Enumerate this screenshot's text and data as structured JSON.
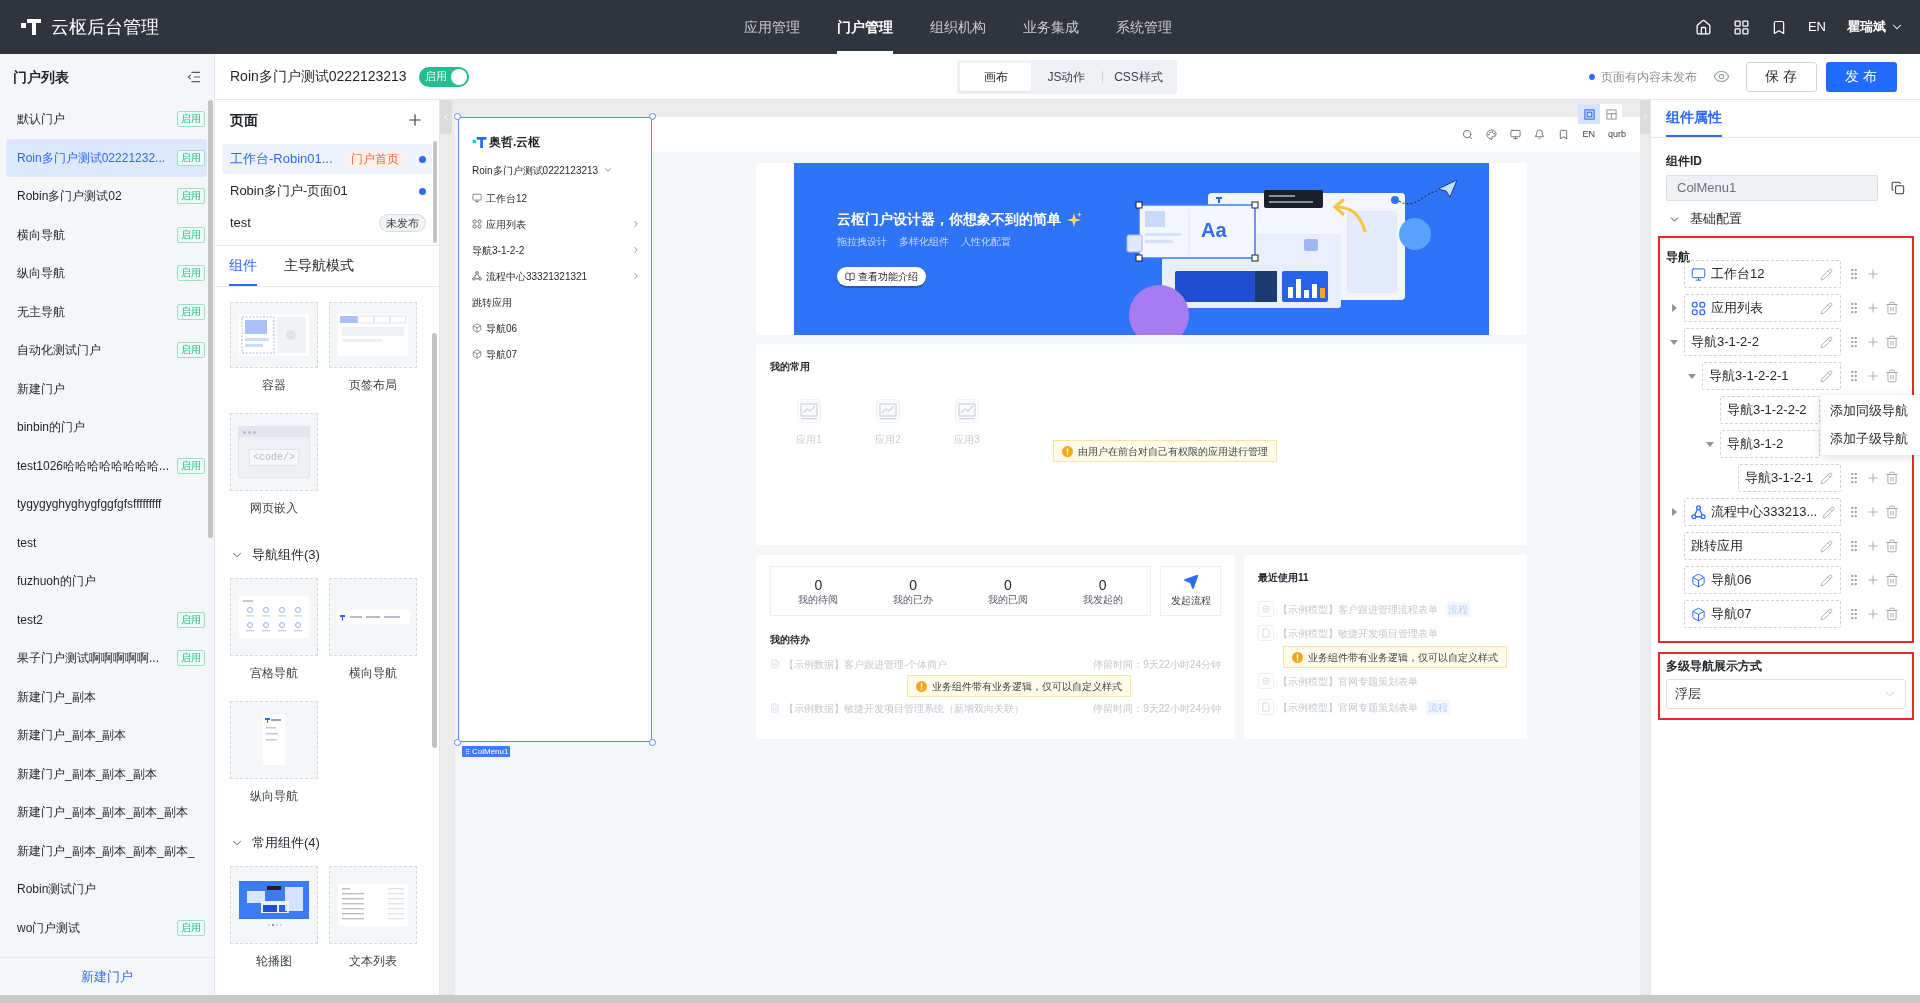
{
  "topbar": {
    "brand": "云枢后台管理",
    "nav": [
      {
        "label": "应用管理",
        "selected": false
      },
      {
        "label": "门户管理",
        "selected": true
      },
      {
        "label": "组织机构",
        "selected": false
      },
      {
        "label": "业务集成",
        "selected": false
      },
      {
        "label": "系统管理",
        "selected": false
      }
    ],
    "language": "EN",
    "user": "瞿瑞斌"
  },
  "portal_list": {
    "title": "门户列表",
    "items": [
      {
        "name": "默认门户",
        "badge": "启用",
        "selected": false
      },
      {
        "name": "Roin多门户测试02221232...",
        "badge": "启用",
        "selected": true
      },
      {
        "name": "Robin多门户测试02",
        "badge": "启用",
        "selected": false
      },
      {
        "name": "横向导航",
        "badge": "启用",
        "selected": false
      },
      {
        "name": "纵向导航",
        "badge": "启用",
        "selected": false
      },
      {
        "name": "无主导航",
        "badge": "启用",
        "selected": false
      },
      {
        "name": "自动化测试门户",
        "badge": "启用",
        "selected": false
      },
      {
        "name": "新建门户",
        "selected": false
      },
      {
        "name": "binbin的门户",
        "selected": false
      },
      {
        "name": "test1026哈哈哈哈哈哈哈哈...",
        "badge": "启用",
        "selected": false
      },
      {
        "name": "tygygyghyghygfggfgfsfffffffff",
        "selected": false
      },
      {
        "name": "test",
        "selected": false
      },
      {
        "name": "fuzhuoh的门户",
        "selected": false
      },
      {
        "name": "test2",
        "badge": "启用",
        "selected": false
      },
      {
        "name": "果子门户测试啊啊啊啊啊...",
        "badge": "启用",
        "selected": false
      },
      {
        "name": "新建门户_副本",
        "selected": false
      },
      {
        "name": "新建门户_副本_副本",
        "selected": false
      },
      {
        "name": "新建门户_副本_副本_副本",
        "selected": false
      },
      {
        "name": "新建门户_副本_副本_副本_副本",
        "selected": false
      },
      {
        "name": "新建门户_副本_副本_副本_副本_",
        "selected": false
      },
      {
        "name": "Robin测试门户",
        "selected": false
      },
      {
        "name": "wo门户测试",
        "badge": "启用",
        "selected": false
      }
    ],
    "new_button": "新建门户"
  },
  "editor_header": {
    "portal_name": "Roin多门户测试0222123213",
    "toggle": {
      "label": "启用",
      "on": true
    },
    "modes": [
      {
        "label": "画布",
        "selected": true
      },
      {
        "label": "JS动作",
        "selected": false
      },
      {
        "label": "CSS样式",
        "selected": false
      }
    ],
    "status": "页面有内容未发布",
    "save": "保存",
    "publish": "发布"
  },
  "pages": {
    "title": "页面",
    "items": [
      {
        "name": "工作台-Robin01...",
        "badge": {
          "text": "门户首页",
          "kind": "home"
        },
        "dot": true,
        "selected": true
      },
      {
        "name": "Robin多门户-页面01",
        "dot": true,
        "selected": false
      },
      {
        "name": "test",
        "badge": {
          "text": "未发布",
          "kind": "draft"
        },
        "dot": false,
        "selected": false
      }
    ]
  },
  "library": {
    "tabs": [
      {
        "label": "组件",
        "selected": true
      },
      {
        "label": "主导航模式",
        "selected": false
      }
    ],
    "groups": [
      {
        "components": [
          {
            "label": "容器",
            "kind": "container"
          },
          {
            "label": "页签布局",
            "kind": "tabs"
          },
          {
            "label": "网页嵌入",
            "kind": "embed",
            "thumbnail_text": "<code/>"
          }
        ]
      },
      {
        "title": "导航组件(3)",
        "expanded": true,
        "components": [
          {
            "label": "宫格导航",
            "kind": "grid_nav"
          },
          {
            "label": "横向导航",
            "kind": "horizontal_nav"
          },
          {
            "label": "纵向导航",
            "kind": "vertical_nav"
          }
        ]
      },
      {
        "title": "常用组件(4)",
        "expanded": true,
        "components": [
          {
            "label": "轮播图",
            "kind": "carousel"
          },
          {
            "label": "文本列表",
            "kind": "text_list"
          }
        ]
      }
    ]
  },
  "canvas": {
    "view_toggles": [
      {
        "selected": true
      },
      {
        "selected": false
      }
    ],
    "preview": {
      "nav_menu": {
        "tag": "ColMenu1",
        "selected": true,
        "logo": "奥哲.云枢",
        "portal": "Roin多门户测试0222123213",
        "items": [
          {
            "label": "工作台12",
            "kind": "workbench",
            "has_children": false
          },
          {
            "label": "应用列表",
            "kind": "catalog",
            "has_children": true
          },
          {
            "label": "导航3-1-2-2",
            "has_children": true
          },
          {
            "label": "流程中心33321321321",
            "kind": "process",
            "has_children": true
          },
          {
            "label": "跳转应用",
            "has_children": false
          },
          {
            "label": "导航06",
            "kind": "module",
            "has_children": false
          },
          {
            "label": "导航07",
            "kind": "module",
            "has_children": false
          }
        ]
      },
      "header": {
        "language": "EN",
        "user": "qurb"
      },
      "banner": {
        "title": "云枢门户设计器，你想象不到的简单",
        "taglines": [
          "拖拉拽设计",
          "多样化组件",
          "人性化配置"
        ],
        "button": "查看功能介绍",
        "illustration_text": "Aa"
      },
      "favorites": {
        "title": "我的常用",
        "apps": [
          "应用1",
          "应用2",
          "应用3"
        ],
        "notice": "由用户在前台对自己有权限的应用进行管理"
      },
      "tasks": {
        "stats": [
          {
            "value": "0",
            "label": "我的待阅"
          },
          {
            "value": "0",
            "label": "我的已办"
          },
          {
            "value": "0",
            "label": "我的已阅"
          },
          {
            "value": "0",
            "label": "我发起的"
          }
        ],
        "start_button": "发起流程",
        "title": "我的待办",
        "rows": [
          {
            "title": "【示例数据】客户跟进管理-个体商户",
            "time": "停留时间：9天22小时24分钟"
          },
          {
            "title": "【示例数据】敏捷开发项目管理系统（新增双向关联）",
            "time": "停留时间：9天22小时24分钟"
          }
        ],
        "notice": "业务组件带有业务逻辑，仅可以自定义样式"
      },
      "recent": {
        "title": "最近使用11",
        "rows": [
          {
            "title": "【示例模型】客户跟进管理流程表单",
            "kind": "process",
            "tag": "流程"
          },
          {
            "title": "【示例模型】敏捷开发项目管理表单",
            "kind": "form"
          },
          {
            "title": "【示例模型】官网专题策划表单",
            "kind": "process"
          },
          {
            "title": "【示例模型】官网专题策划表单",
            "kind": "form",
            "tag": "流程"
          }
        ],
        "notice": "业务组件带有业务逻辑，仅可以自定义样式"
      }
    }
  },
  "properties": {
    "tab": {
      "label": "组件属性",
      "selected": true
    },
    "id_label": "组件ID",
    "id_value": "ColMenu1",
    "section": {
      "title": "基础配置",
      "expanded": true
    },
    "nav_tree": {
      "title": "导航",
      "highlighted": true,
      "menu": [
        "添加同级导航",
        "添加子级导航"
      ],
      "items": [
        {
          "label": "工作台12",
          "kind": "workbench",
          "has_children": false,
          "deletable": false,
          "menu_open": false
        },
        {
          "label": "应用列表",
          "kind": "catalog",
          "has_children": true,
          "expanded": false,
          "deletable": true,
          "menu_open": false
        },
        {
          "label": "导航3-1-2-2",
          "has_children": true,
          "expanded": true,
          "deletable": true,
          "menu_open": false,
          "children": [
            {
              "label": "导航3-1-2-2-1",
              "has_children": true,
              "expanded": true,
              "deletable": true,
              "menu_open": true,
              "children": [
                {
                  "label": "导航3-1-2-2-2",
                  "has_children": false,
                  "menu_open": false
                },
                {
                  "label": "导航3-1-2",
                  "has_children": true,
                  "expanded": true,
                  "menu_open": false,
                  "children": [
                    {
                      "label": "导航3-1-2-1",
                      "has_children": false,
                      "deletable": true,
                      "menu_open": false
                    }
                  ]
                }
              ]
            }
          ]
        },
        {
          "label": "流程中心333213...",
          "kind": "process",
          "has_children": true,
          "expanded": false,
          "deletable": true,
          "menu_open": false
        },
        {
          "label": "跳转应用",
          "has_children": false,
          "deletable": true,
          "menu_open": false
        },
        {
          "label": "导航06",
          "kind": "module",
          "has_children": false,
          "deletable": true,
          "menu_open": false
        },
        {
          "label": "导航07",
          "kind": "module",
          "has_children": false,
          "deletable": true,
          "menu_open": false
        }
      ]
    },
    "display_mode": {
      "label": "多级导航展示方式",
      "value": "浮层",
      "highlighted": true
    }
  }
}
